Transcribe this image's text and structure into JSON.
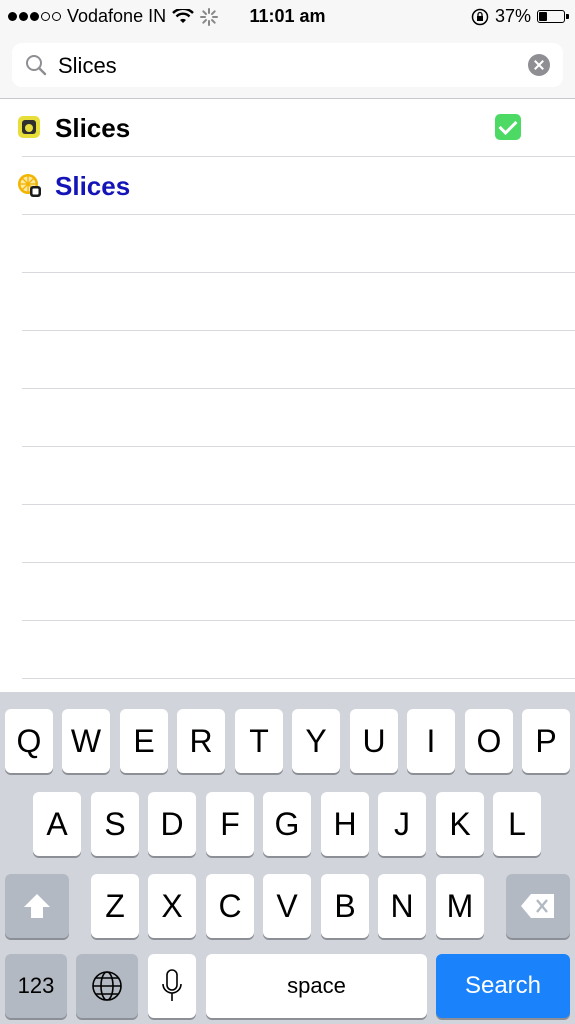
{
  "status_bar": {
    "carrier": "Vodafone IN",
    "time": "11:01 am",
    "battery": "37%",
    "battery_level": 0.37,
    "signal_bars_filled": 3,
    "signal_bars_total": 5
  },
  "search": {
    "value": "Slices",
    "icon": "magnifier-icon",
    "clear_icon": "clear-circle-icon"
  },
  "results": [
    {
      "label": "Slices",
      "icon": "slices-app-icon",
      "checked": true,
      "color": "#000000"
    },
    {
      "label": "Slices",
      "icon": "slices-package-icon",
      "checked": false,
      "color": "#1414b8"
    }
  ],
  "keyboard": {
    "row1": [
      "Q",
      "W",
      "E",
      "R",
      "T",
      "Y",
      "U",
      "I",
      "O",
      "P"
    ],
    "row2": [
      "A",
      "S",
      "D",
      "F",
      "G",
      "H",
      "J",
      "K",
      "L"
    ],
    "row3": [
      "Z",
      "X",
      "C",
      "V",
      "B",
      "N",
      "M"
    ],
    "numbers_key": "123",
    "space_key": "space",
    "search_key": "Search",
    "accent_color": "#1a82fb"
  }
}
